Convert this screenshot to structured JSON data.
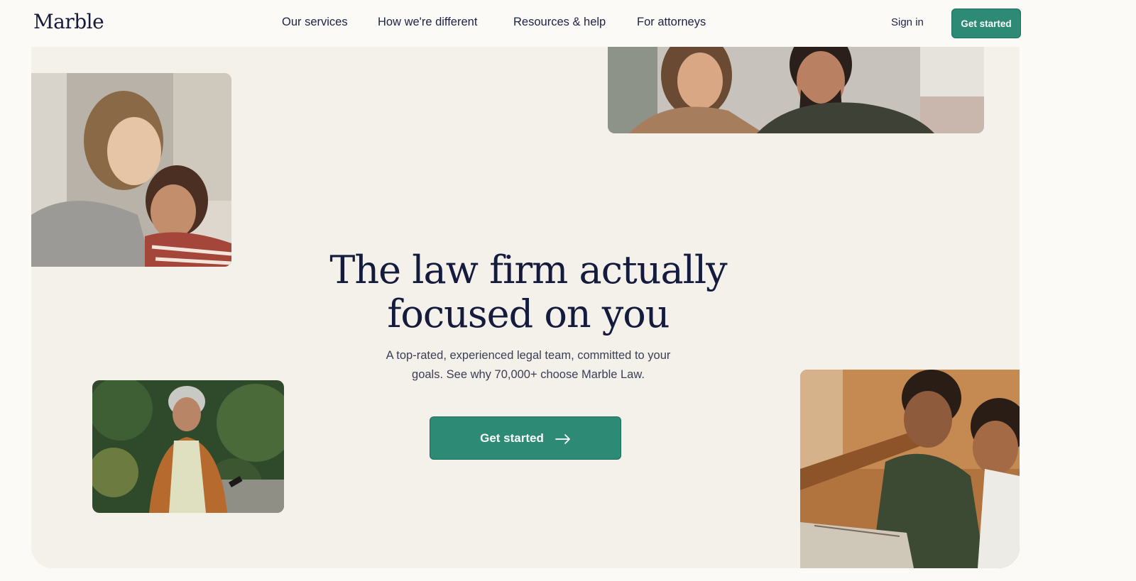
{
  "header": {
    "logo": "Marble",
    "nav": [
      {
        "label": "Our services"
      },
      {
        "label": "How we're different"
      },
      {
        "label": "Resources & help"
      },
      {
        "label": "For attorneys"
      }
    ],
    "sign_in": "Sign in",
    "cta": "Get started"
  },
  "hero": {
    "headline_line1": "The law firm actually",
    "headline_line2": "focused on you",
    "subtitle_line1": "A top-rated, experienced legal team, committed to your",
    "subtitle_line2": "goals. See why 70,000+ choose Marble Law.",
    "cta": "Get started",
    "cta_icon": "arrow-right-icon"
  },
  "colors": {
    "accent": "#2d8a75",
    "text": "#141b3c",
    "hero_bg": "#f4f0ea",
    "page_bg": "#fbfaf7"
  }
}
